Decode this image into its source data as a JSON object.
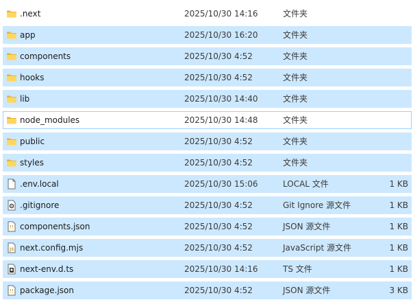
{
  "files": [
    {
      "name": ".next",
      "date": "2025/10/30 14:16",
      "type": "文件夹",
      "size": "",
      "icon": "folder-icon",
      "state": "none"
    },
    {
      "name": "app",
      "date": "2025/10/30 16:20",
      "type": "文件夹",
      "size": "",
      "icon": "folder-icon",
      "state": "selected"
    },
    {
      "name": "components",
      "date": "2025/10/30 4:52",
      "type": "文件夹",
      "size": "",
      "icon": "folder-icon",
      "state": "selected"
    },
    {
      "name": "hooks",
      "date": "2025/10/30 4:52",
      "type": "文件夹",
      "size": "",
      "icon": "folder-icon",
      "state": "selected"
    },
    {
      "name": "lib",
      "date": "2025/10/30 14:40",
      "type": "文件夹",
      "size": "",
      "icon": "folder-icon",
      "state": "selected"
    },
    {
      "name": "node_modules",
      "date": "2025/10/30 14:48",
      "type": "文件夹",
      "size": "",
      "icon": "folder-icon",
      "state": "focused"
    },
    {
      "name": "public",
      "date": "2025/10/30 4:52",
      "type": "文件夹",
      "size": "",
      "icon": "folder-icon",
      "state": "selected"
    },
    {
      "name": "styles",
      "date": "2025/10/30 4:52",
      "type": "文件夹",
      "size": "",
      "icon": "folder-icon",
      "state": "selected"
    },
    {
      "name": ".env.local",
      "date": "2025/10/30 15:06",
      "type": "LOCAL 文件",
      "size": "1 KB",
      "icon": "blank-file-icon",
      "state": "selected"
    },
    {
      "name": ".gitignore",
      "date": "2025/10/30 4:52",
      "type": "Git Ignore 源文件",
      "size": "1 KB",
      "icon": "gear-file-icon",
      "state": "selected"
    },
    {
      "name": "components.json",
      "date": "2025/10/30 4:52",
      "type": "JSON 源文件",
      "size": "1 KB",
      "icon": "json-file-icon",
      "state": "selected"
    },
    {
      "name": "next.config.mjs",
      "date": "2025/10/30 4:52",
      "type": "JavaScript 源文件",
      "size": "1 KB",
      "icon": "js-file-icon",
      "state": "selected"
    },
    {
      "name": "next-env.d.ts",
      "date": "2025/10/30 14:16",
      "type": "TS 文件",
      "size": "1 KB",
      "icon": "ts-file-icon",
      "state": "selected"
    },
    {
      "name": "package.json",
      "date": "2025/10/30 4:52",
      "type": "JSON 源文件",
      "size": "3 KB",
      "icon": "json-file-icon",
      "state": "selected"
    }
  ],
  "colors": {
    "selection_bg": "#cce8ff",
    "focus_border": "#99d1ff",
    "folder_yellow": "#ffd75e"
  }
}
